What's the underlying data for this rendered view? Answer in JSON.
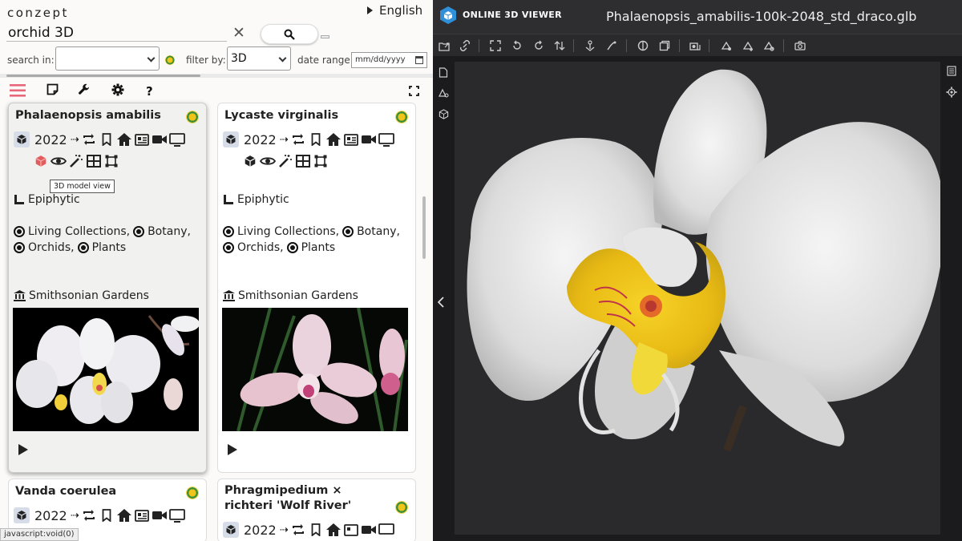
{
  "app": {
    "brand": "conzept",
    "language": "English"
  },
  "search": {
    "value": "orchid 3D",
    "clear_label": "✕"
  },
  "filters": {
    "search_in_label": "search in:",
    "search_in_value": "",
    "filter_by_label": "filter by:",
    "filter_by_value": "3D",
    "date_range_label": "date range:",
    "date_placeholder": "mm/dd/yyyy"
  },
  "tooltip": "3D model view",
  "status_bar": "javascript:void(0)",
  "cards": [
    {
      "title": "Phalaenopsis amabilis",
      "year": "2022",
      "habit": "Epiphytic",
      "tags": [
        "Living Collections,",
        "Botany,",
        "Orchids,",
        "Plants"
      ],
      "institution": "Smithsonian Gardens"
    },
    {
      "title": "Lycaste virginalis",
      "year": "2022",
      "habit": "Epiphytic",
      "tags": [
        "Living Collections,",
        "Botany,",
        "Orchids,",
        "Plants"
      ],
      "institution": "Smithsonian Gardens"
    },
    {
      "title": "Vanda coerulea",
      "year": "2022"
    },
    {
      "title": "Phragmipedium × richteri 'Wolf River'",
      "year": "2022"
    }
  ],
  "viewer": {
    "brand": "ONLINE 3D VIEWER",
    "filename": "Phalaenopsis_amabilis-100k-2048_std_draco.glb",
    "accent_color": "#2f8fd8"
  },
  "icons": {
    "toolbar": [
      "menu-icon",
      "note-icon",
      "wrench-icon",
      "gear-icon",
      "help-icon",
      "fullscreen-icon"
    ],
    "viewer_toolbar": [
      "open-file-icon",
      "open-url-icon",
      "fit-icon",
      "rotate-up-icon",
      "rotate-left-icon",
      "flip-icon",
      "fix-up-icon",
      "free-orbit-icon",
      "edges-icon",
      "model-icon",
      "snapshot-icon",
      "measure-icon",
      "export-icon",
      "share-icon",
      "camera-icon"
    ]
  }
}
